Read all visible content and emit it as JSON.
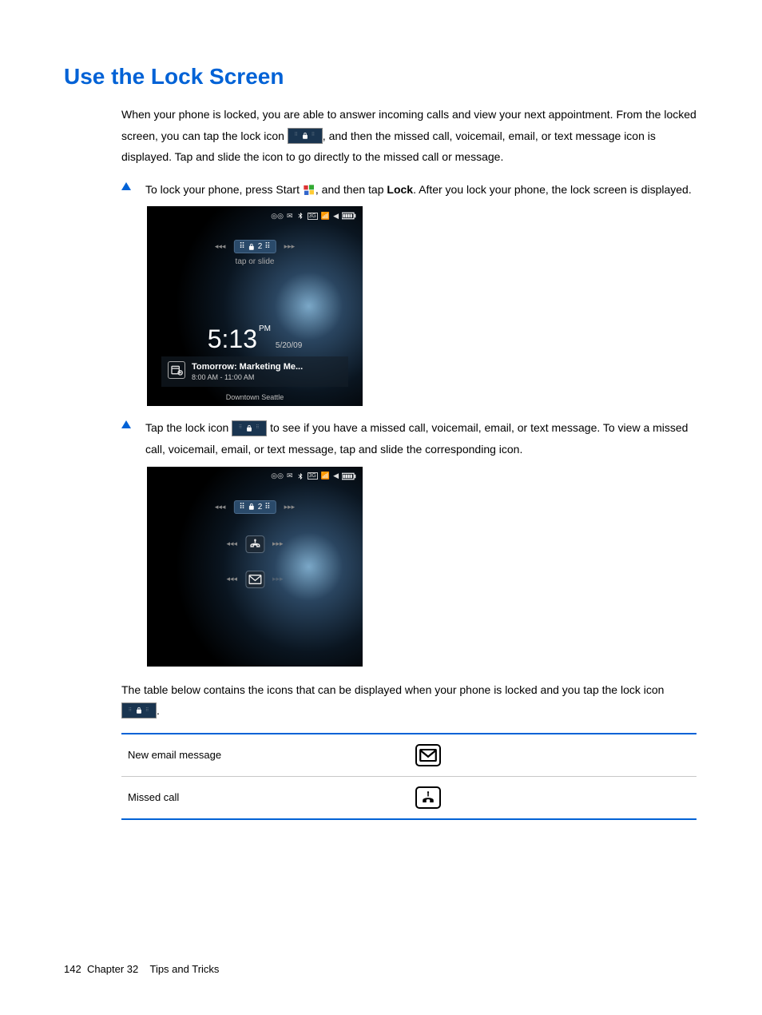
{
  "heading": "Use the Lock Screen",
  "intro_1a": "When your phone is locked, you are able to answer incoming calls and view your next appointment. From the locked screen, you can tap the lock icon ",
  "intro_1b": ", and then the missed call, voicemail, email, or text message icon is displayed. Tap and slide the icon to go directly to the missed call or message.",
  "bullet1_a": "To lock your phone, press Start ",
  "bullet1_b": ", and then tap ",
  "bullet1_lock": "Lock",
  "bullet1_c": ". After you lock your phone, the lock screen is displayed.",
  "phone1": {
    "slider_badge": "2",
    "tap_label": "tap or slide",
    "time": "5:13",
    "ampm": "PM",
    "date": "5/20/09",
    "appt_title": "Tomorrow: Marketing Me...",
    "appt_time": "8:00 AM - 11:00 AM",
    "appt_loc": "Downtown Seattle"
  },
  "bullet2_a": "Tap the lock icon ",
  "bullet2_b": " to see if you have a missed call, voicemail, email, or text message. To view a missed call, voicemail, email, or text message, tap and slide the corresponding icon.",
  "phone2": {
    "slider_badge": "2"
  },
  "post_a": "The table below contains the icons that can be displayed when your phone is locked and you tap the lock icon ",
  "post_b": ".",
  "table": {
    "row1": "New email message",
    "row2": "Missed call"
  },
  "footer": {
    "page": "142",
    "chapter": "Chapter 32",
    "title": "Tips and Tricks"
  }
}
